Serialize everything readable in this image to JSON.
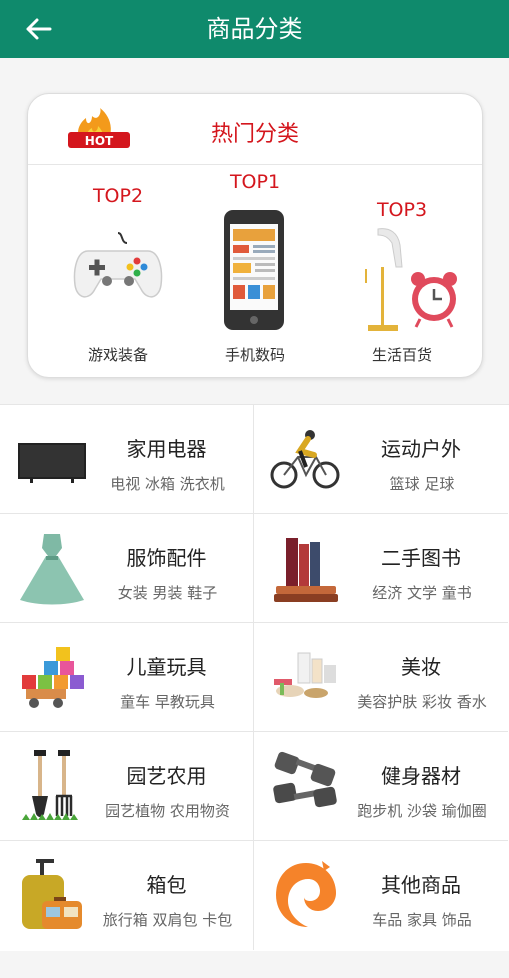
{
  "app": {
    "title": "商品分类"
  },
  "hot": {
    "badge_text": "HOT",
    "title": "热门分类",
    "items": [
      {
        "rank": "TOP2",
        "label": "游戏装备",
        "icon": "gamepad-icon"
      },
      {
        "rank": "TOP1",
        "label": "手机数码",
        "icon": "smartphone-icon"
      },
      {
        "rank": "TOP3",
        "label": "生活百货",
        "icon": "alarm-clock-icon"
      }
    ]
  },
  "categories": [
    {
      "title": "家用电器",
      "sub": "电视 冰箱 洗衣机",
      "icon": "tv-icon"
    },
    {
      "title": "运动户外",
      "sub": "篮球 足球",
      "icon": "bicycle-icon"
    },
    {
      "title": "服饰配件",
      "sub": "女装 男装 鞋子",
      "icon": "dress-icon"
    },
    {
      "title": "二手图书",
      "sub": "经济 文学 童书",
      "icon": "books-icon"
    },
    {
      "title": "儿童玩具",
      "sub": "童车 早教玩具",
      "icon": "toy-blocks-icon"
    },
    {
      "title": "美妆",
      "sub": "美容护肤 彩妆 香水",
      "icon": "cosmetics-icon"
    },
    {
      "title": "园艺农用",
      "sub": "园艺植物 农用物资",
      "icon": "garden-tools-icon"
    },
    {
      "title": "健身器材",
      "sub": "跑步机 沙袋 瑜伽圈",
      "icon": "dumbbell-icon"
    },
    {
      "title": "箱包",
      "sub": "旅行箱 双肩包 卡包",
      "icon": "luggage-icon"
    },
    {
      "title": "其他商品",
      "sub": "车品 家具 饰品",
      "icon": "origin-swirl-icon"
    }
  ]
}
